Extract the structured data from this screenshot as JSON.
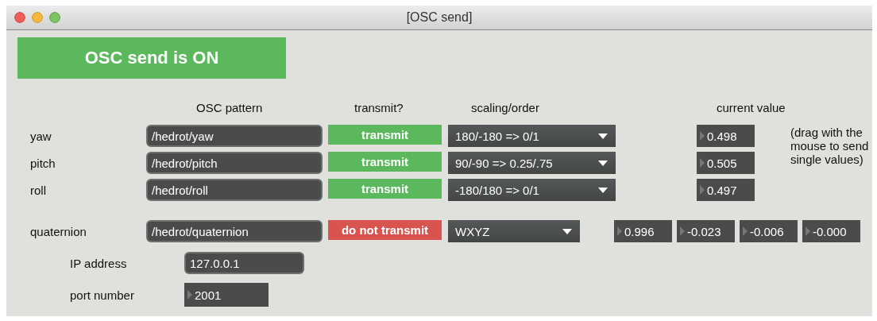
{
  "window": {
    "title": "[OSC send]"
  },
  "status": {
    "label": "OSC send is ON",
    "on": true
  },
  "headers": [
    "OSC pattern",
    "transmit?",
    "scaling/order",
    "current value"
  ],
  "rows": [
    {
      "label": "yaw",
      "pattern": "/hedrot/yaw",
      "transmit": {
        "label": "transmit",
        "on": true
      },
      "scaling": "180/-180 => 0/1",
      "value": "0.498"
    },
    {
      "label": "pitch",
      "pattern": "/hedrot/pitch",
      "transmit": {
        "label": "transmit",
        "on": true
      },
      "scaling": "90/-90 => 0.25/.75",
      "value": "0.505"
    },
    {
      "label": "roll",
      "pattern": "/hedrot/roll",
      "transmit": {
        "label": "transmit",
        "on": true
      },
      "scaling": "-180/180 => 0/1",
      "value": "0.497"
    }
  ],
  "note": "(drag with the mouse to send single values)",
  "quaternion": {
    "label": "quaternion",
    "pattern": "/hedrot/quaternion",
    "transmit": {
      "label": "do not transmit",
      "on": false
    },
    "scaling": "WXYZ",
    "values": [
      "0.996",
      "-0.023",
      "-0.006",
      "-0.000"
    ]
  },
  "ip": {
    "label": "IP address",
    "value": "127.0.0.1"
  },
  "port": {
    "label": "port number",
    "value": "2001"
  }
}
